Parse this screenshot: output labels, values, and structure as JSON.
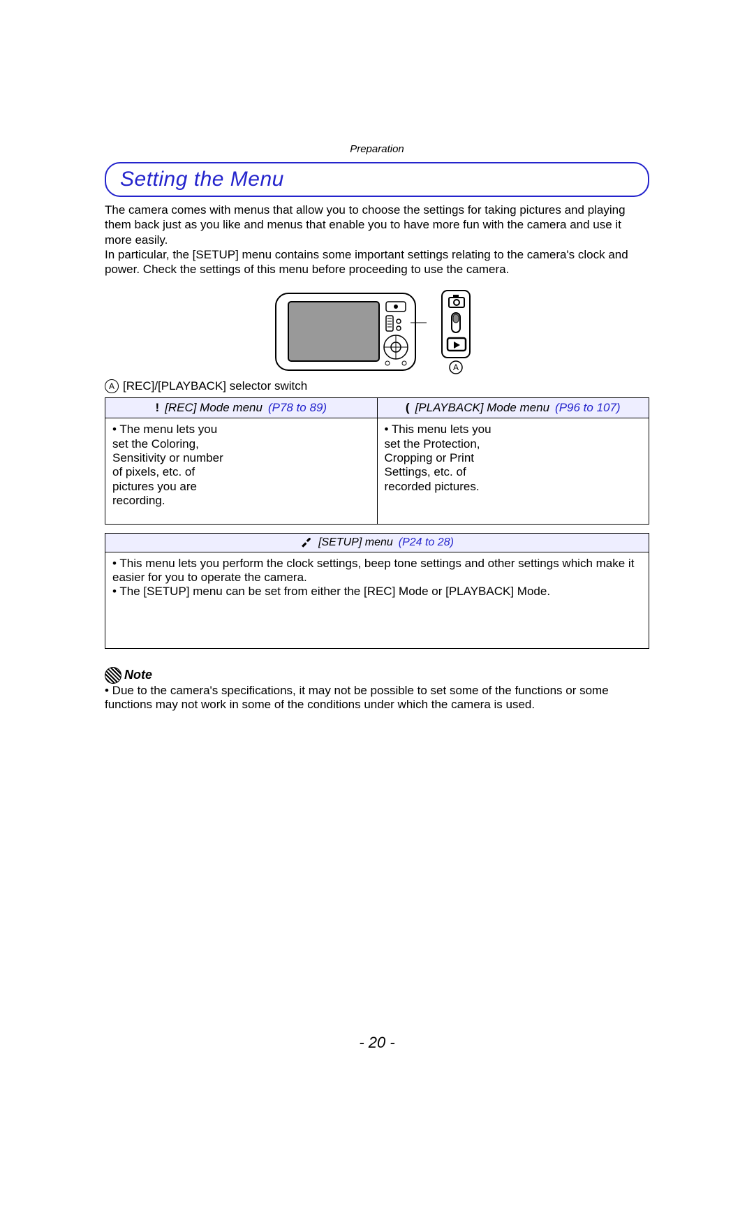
{
  "header": {
    "section": "Preparation"
  },
  "title": "Setting the Menu",
  "intro": "The camera comes with menus that allow you to choose the settings for taking pictures and playing them back just as you like and menus that enable you to have more fun with the camera and use it more easily.\nIn particular, the [SETUP] menu contains some important settings relating to the camera's clock and power. Check the settings of this menu before proceeding to use the camera.",
  "switchLabel": {
    "letter": "A",
    "text": "[REC]/[PLAYBACK] selector switch"
  },
  "tables": {
    "rec": {
      "iconGlyph": "!",
      "label": "[REC] Mode menu",
      "link": "(P78 to 89)",
      "body": "• The menu lets you set the Coloring, Sensitivity or number of pixels, etc. of pictures you are recording."
    },
    "playback": {
      "iconGlyph": "(",
      "label": "[PLAYBACK] Mode menu",
      "link": "(P96 to 107)",
      "body": "• This menu lets you set the Protection, Cropping or Print Settings, etc. of recorded pictures."
    },
    "setup": {
      "label": "[SETUP] menu",
      "link": "(P24 to 28)",
      "body1": "• This menu lets you perform the clock settings, beep tone settings and other settings which make it easier for you to operate the camera.",
      "body2": "• The [SETUP] menu can be set from either the [REC] Mode or [PLAYBACK] Mode."
    }
  },
  "note": {
    "heading": "Note",
    "body": "• Due to the camera's specifications, it may not be possible to set some of the functions or some functions may not work in some of the conditions under which the camera is used."
  },
  "pageNumber": "- 20 -"
}
